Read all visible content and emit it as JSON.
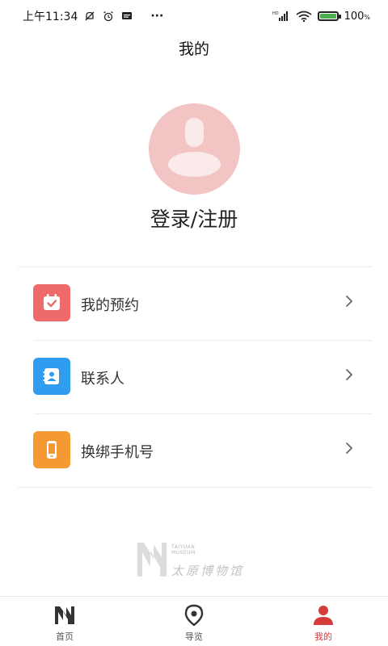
{
  "statusbar": {
    "time": "上午11:34",
    "more": "···",
    "signal_label": "HD",
    "battery": "100",
    "battery_unit": "%"
  },
  "header": {
    "title": "我的"
  },
  "profile": {
    "login_label": "登录/注册"
  },
  "menu": {
    "items": [
      {
        "label": "我的预约",
        "icon": "calendar-check-icon",
        "color": "#ef6a6a"
      },
      {
        "label": "联系人",
        "icon": "contact-card-icon",
        "color": "#2f9cef"
      },
      {
        "label": "换绑手机号",
        "icon": "phone-icon",
        "color": "#f59a33"
      }
    ]
  },
  "footer_logo": {
    "en_line1": "TAIYUAN",
    "en_line2": "MUSEUM",
    "cn": "太原博物馆"
  },
  "tabbar": {
    "tabs": [
      {
        "label": "首页",
        "icon": "museum-logo-icon"
      },
      {
        "label": "导览",
        "icon": "location-pin-icon"
      },
      {
        "label": "我的",
        "icon": "user-icon",
        "active": true
      }
    ]
  },
  "colors": {
    "accent": "#d43b3b",
    "avatar": "#f3c4c4"
  }
}
